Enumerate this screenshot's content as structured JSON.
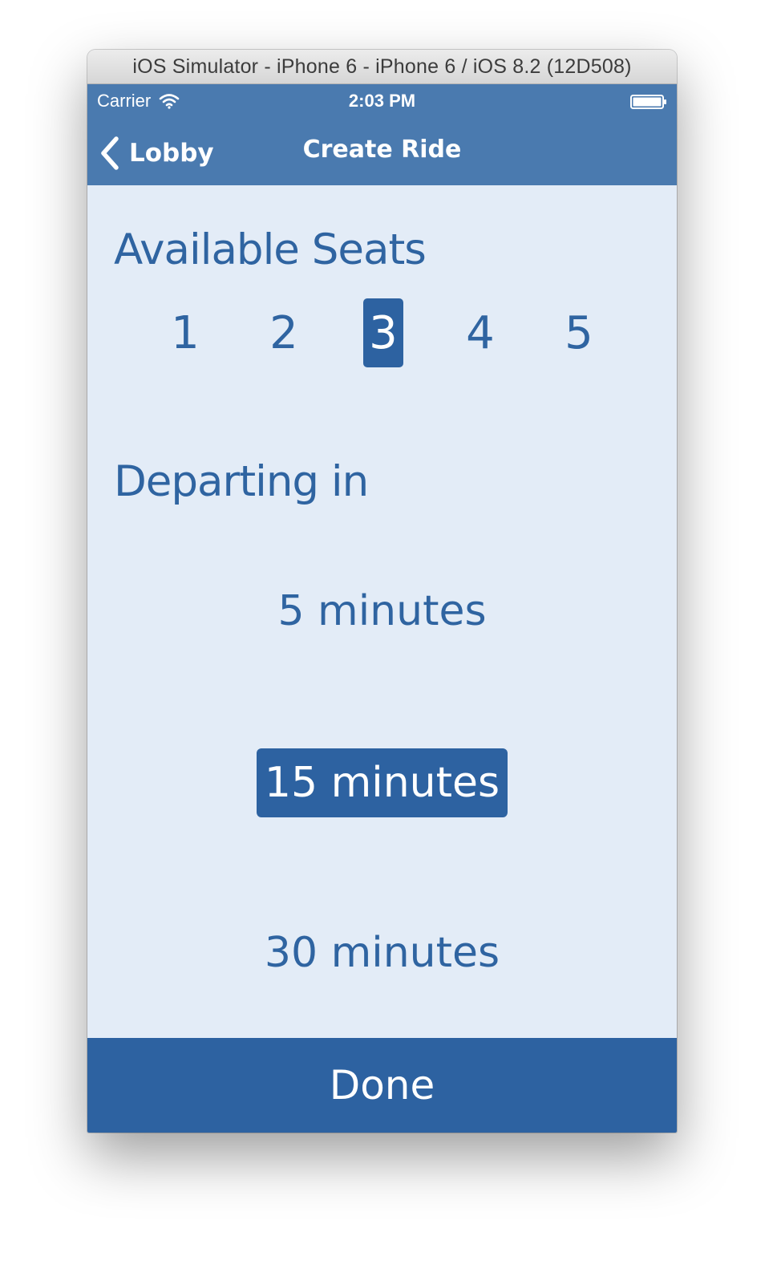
{
  "window": {
    "title": "iOS Simulator - iPhone 6 - iPhone 6 / iOS 8.2 (12D508)"
  },
  "status_bar": {
    "carrier": "Carrier",
    "wifi_icon": "wifi-icon",
    "time": "2:03 PM",
    "battery_icon": "battery-icon"
  },
  "nav": {
    "back_icon": "chevron-left-icon",
    "back_label": "Lobby",
    "title": "Create Ride"
  },
  "seats": {
    "title": "Available Seats",
    "options": [
      "1",
      "2",
      "3",
      "4",
      "5"
    ],
    "selected": "3"
  },
  "departure": {
    "title": "Departing in",
    "options": [
      "5 minutes",
      "15 minutes",
      "30 minutes"
    ],
    "selected": "15 minutes"
  },
  "footer": {
    "done_label": "Done"
  },
  "colors": {
    "nav_bar": "#4a7aaf",
    "background": "#e3ecf7",
    "accent": "#2d62a1",
    "text": "#2f64a1"
  }
}
